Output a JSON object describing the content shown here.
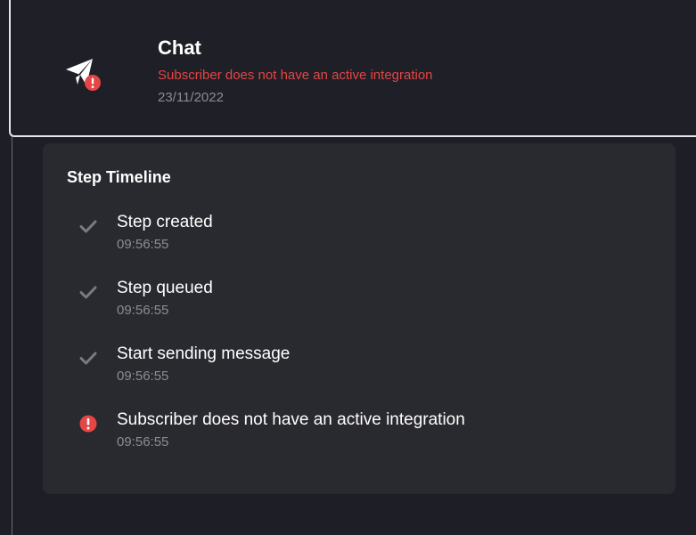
{
  "step": {
    "title": "Chat",
    "status_message": "Subscriber does not have an active integration",
    "date": "23/11/2022",
    "icon": "paper-plane-icon",
    "status_icon": "error-alert-icon"
  },
  "timeline": {
    "title": "Step Timeline",
    "items": [
      {
        "label": "Step created",
        "time": "09:56:55",
        "status": "success",
        "icon": "check-icon"
      },
      {
        "label": "Step queued",
        "time": "09:56:55",
        "status": "success",
        "icon": "check-icon"
      },
      {
        "label": "Start sending message",
        "time": "09:56:55",
        "status": "success",
        "icon": "check-icon"
      },
      {
        "label": "Subscriber does not have an active integration",
        "time": "09:56:55",
        "status": "error",
        "icon": "error-alert-icon"
      }
    ]
  },
  "colors": {
    "background": "#1e1e26",
    "panel": "#292930",
    "error": "#e54545",
    "muted": "#8c8c94",
    "check": "#7a7a82"
  }
}
